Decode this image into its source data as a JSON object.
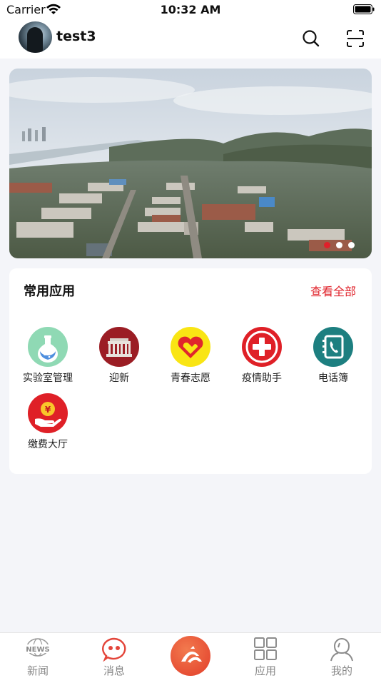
{
  "status_bar": {
    "carrier": "Carrier",
    "time": "10:32 AM"
  },
  "header": {
    "username": "test3"
  },
  "banner": {
    "slide_count": 3,
    "active_slide": 1
  },
  "apps_section": {
    "title": "常用应用",
    "view_all": "查看全部",
    "apps": [
      {
        "label": "实验室管理",
        "icon": "flask-icon"
      },
      {
        "label": "迎新",
        "icon": "campus-gate-icon"
      },
      {
        "label": "青春志愿",
        "icon": "heart-hand-icon"
      },
      {
        "label": "疫情助手",
        "icon": "medical-cross-icon"
      },
      {
        "label": "电话簿",
        "icon": "phonebook-icon"
      },
      {
        "label": "缴费大厅",
        "icon": "payment-hand-icon"
      }
    ]
  },
  "tabbar": {
    "tabs": [
      {
        "label": "新闻",
        "icon": "news-icon"
      },
      {
        "label": "消息",
        "icon": "message-icon"
      },
      {
        "label": "",
        "icon": "home-logo-icon"
      },
      {
        "label": "应用",
        "icon": "grid-icon"
      },
      {
        "label": "我的",
        "icon": "profile-icon"
      }
    ]
  },
  "colors": {
    "accent": "#e0242c",
    "background": "#f4f5f9"
  }
}
